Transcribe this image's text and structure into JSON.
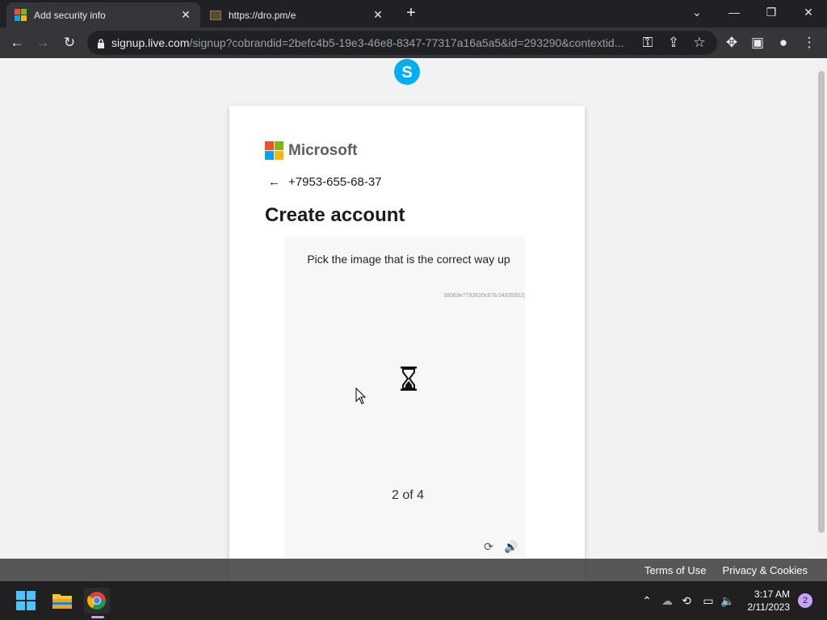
{
  "browser": {
    "tabs": [
      {
        "title": "Add security info",
        "icon": "microsoft-logo-icon",
        "active": true
      },
      {
        "title": "https://dro.pm/e",
        "icon": "page-icon",
        "active": false
      }
    ],
    "url_host": "signup.live.com",
    "url_path": "/signup?cobrandid=2befc4b5-19e3-46e8-8347-77317a16a5a5&id=293290&contextid..."
  },
  "page": {
    "brand_name": "Microsoft",
    "phone": "+7953-655-68-37",
    "heading": "Create account",
    "captcha": {
      "instruction": "Pick the image that is the correct way up",
      "session_id": "38063e7792620c876.04835852|",
      "progress_text": "2 of 4",
      "progress_current": 2,
      "progress_total": 4
    },
    "footer_links": [
      "Terms of Use",
      "Privacy & Cookies"
    ]
  },
  "taskbar": {
    "time": "3:17 AM",
    "date": "2/11/2023",
    "notification_count": "2"
  },
  "colors": {
    "ms_red": "#f25022",
    "ms_green": "#7fba00",
    "ms_blue": "#00a4ef",
    "ms_yellow": "#ffb900",
    "skype_blue": "#00aff0"
  }
}
